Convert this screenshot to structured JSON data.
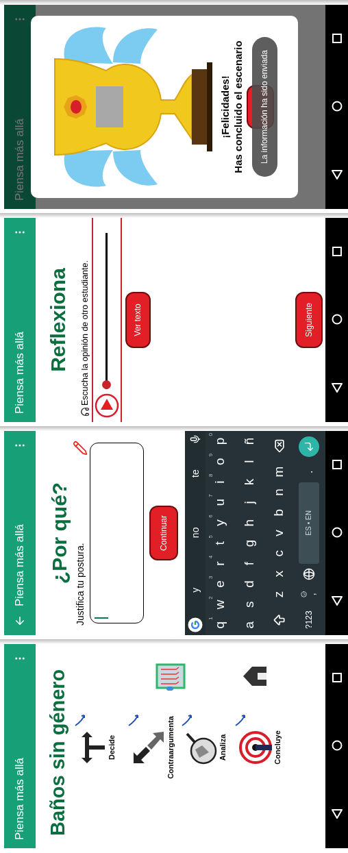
{
  "screens": [
    {
      "kind": "trophy",
      "app_bar": {
        "title": "Piensa más allá",
        "back": false
      },
      "dimmed": true,
      "dialog": {
        "heading": "¡Felicidades!",
        "message": "Has concluido el escenario"
      },
      "toast": "La información ha sido enviada"
    },
    {
      "kind": "listen",
      "app_bar": {
        "title": "Piensa más allá",
        "back": false
      },
      "dimmed": false,
      "title": "Reflexiona",
      "instruction": "Escucha la opinión de otro estudiante.",
      "player": {
        "level": 0
      },
      "buttons": [
        "Ver texto",
        "Siguiente"
      ]
    },
    {
      "kind": "answer",
      "app_bar": {
        "title": "Piensa más allá",
        "back": true
      },
      "dimmed": false,
      "title": "¿Por qué?",
      "prompt": "Justifica tu postura.",
      "button": "Continuar",
      "keyboard": {
        "suggestions": [
          "y",
          "no",
          "te"
        ],
        "rows": [
          {
            "keys": [
              {
                "label": "q",
                "hint": "1"
              },
              {
                "label": "w",
                "hint": "2"
              },
              {
                "label": "e",
                "hint": "3"
              },
              {
                "label": "r",
                "hint": "4"
              },
              {
                "label": "t",
                "hint": "5"
              },
              {
                "label": "y",
                "hint": "6"
              },
              {
                "label": "u",
                "hint": "7"
              },
              {
                "label": "i",
                "hint": "8"
              },
              {
                "label": "o",
                "hint": "9"
              },
              {
                "label": "p",
                "hint": "0"
              }
            ]
          },
          {
            "keys": [
              {
                "label": "a"
              },
              {
                "label": "s"
              },
              {
                "label": "d"
              },
              {
                "label": "f"
              },
              {
                "label": "g"
              },
              {
                "label": "h"
              },
              {
                "label": "j"
              },
              {
                "label": "k"
              },
              {
                "label": "l"
              },
              {
                "label": "ñ"
              }
            ]
          },
          {
            "keys": [
              {
                "label": "z"
              },
              {
                "label": "x"
              },
              {
                "label": "c"
              },
              {
                "label": "v"
              },
              {
                "label": "b"
              },
              {
                "label": "n"
              },
              {
                "label": "m"
              }
            ]
          }
        ],
        "symbols": "?123",
        "comma": ",",
        "space": "ES • EN",
        "period": "."
      }
    },
    {
      "kind": "menu",
      "app_bar": {
        "title": "Piensa más allá",
        "back": false
      },
      "dimmed": false,
      "title": "Baños sin género",
      "steps": [
        {
          "label": "Decide",
          "done": true
        },
        {
          "label": "Contraargumenta",
          "done": true
        },
        {
          "label": "Analiza",
          "done": true
        },
        {
          "label": "Concluye",
          "done": true
        }
      ]
    }
  ]
}
